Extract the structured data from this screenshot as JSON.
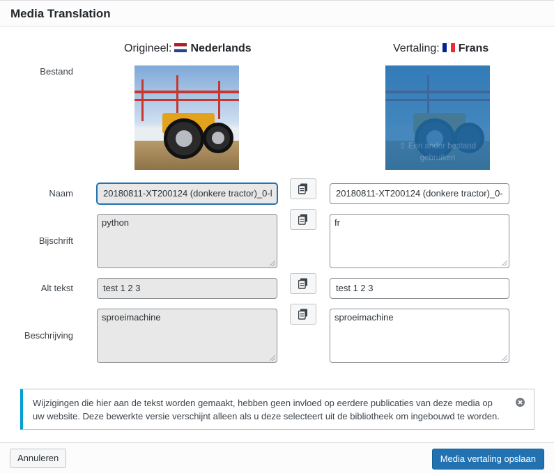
{
  "dialog": {
    "title": "Media Translation"
  },
  "columns": {
    "original": {
      "prefix": "Origineel:",
      "language": "Nederlands",
      "flag": "flag-nl-icon"
    },
    "translation": {
      "prefix": "Vertaling:",
      "language": "Frans",
      "flag": "flag-fr-icon"
    }
  },
  "labels": {
    "file": "Bestand",
    "name": "Naam",
    "caption": "Bijschrift",
    "alt": "Alt tekst",
    "description": "Beschrijving"
  },
  "file": {
    "replace_text": "Een ander bestand gebruiken"
  },
  "fields": {
    "name": {
      "original": "20180811-XT200124 (donkere tractor)_0-l",
      "translation": "20180811-XT200124 (donkere tractor)_0-"
    },
    "caption": {
      "original": "python",
      "translation": "fr"
    },
    "alt": {
      "original": "test 1 2 3",
      "translation": "test 1 2 3"
    },
    "description": {
      "original": "sproeimachine",
      "translation": "sproeimachine"
    }
  },
  "notice": {
    "text": "Wijzigingen die hier aan de tekst worden gemaakt, hebben geen invloed op eerdere publicaties van deze media op uw website. Deze bewerkte versie verschijnt alleen als u deze selecteert uit de bibliotheek om ingebouwd te worden."
  },
  "buttons": {
    "cancel": "Annuleren",
    "save": "Media vertaling opslaan"
  },
  "colors": {
    "accent": "#2271b1",
    "notice_border": "#00a0d2"
  }
}
